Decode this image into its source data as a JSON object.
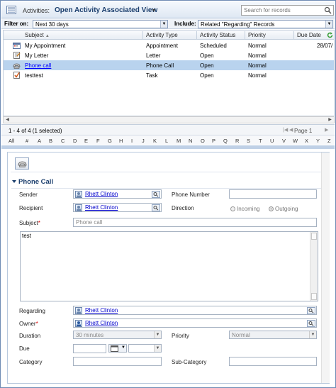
{
  "titlebar": {
    "label": "Activities:",
    "view_title": "Open Activity Associated View",
    "dropdown_symbol": "▾",
    "search_placeholder": "Search for records"
  },
  "filter": {
    "filter_label": "Filter on:",
    "filter_value": "Next 30 days",
    "include_label": "Include:",
    "include_value": "Related \"Regarding\" Records"
  },
  "grid": {
    "columns": [
      "Subject",
      "Activity Type",
      "Activity Status",
      "Priority",
      "Due Date"
    ],
    "sort_indicator": "▲",
    "rows": [
      {
        "icon": "appointment-icon",
        "subject": "My Appointment",
        "type": "Appointment",
        "status": "Scheduled",
        "priority": "Normal",
        "due": "28/07/"
      },
      {
        "icon": "letter-icon",
        "subject": "My Letter",
        "type": "Letter",
        "status": "Open",
        "priority": "Normal",
        "due": ""
      },
      {
        "icon": "phone-call-icon",
        "subject": "Phone call",
        "type": "Phone Call",
        "status": "Open",
        "priority": "Normal",
        "due": ""
      },
      {
        "icon": "task-icon",
        "subject": "testtest",
        "type": "Task",
        "status": "Open",
        "priority": "Normal",
        "due": ""
      }
    ]
  },
  "status": {
    "count_text": "1 - 4 of 4 (1 selected)",
    "page_text": "Page 1"
  },
  "alpha_index": [
    "All",
    "#",
    "A",
    "B",
    "C",
    "D",
    "E",
    "F",
    "G",
    "H",
    "I",
    "J",
    "K",
    "L",
    "M",
    "N",
    "O",
    "P",
    "Q",
    "R",
    "S",
    "T",
    "U",
    "V",
    "W",
    "X",
    "Y",
    "Z"
  ],
  "form": {
    "section_title": "Phone Call",
    "sender_label": "Sender",
    "sender_value": "Rhett Clinton",
    "phone_label": "Phone Number",
    "recipient_label": "Recipient",
    "recipient_value": "Rhett Clinton",
    "direction_label": "Direction",
    "direction_incoming": "Incoming",
    "direction_outgoing": "Outgoing",
    "subject_label": "Subject",
    "subject_value": "Phone call",
    "description_value": "test",
    "regarding_label": "Regarding",
    "regarding_value": "Rhett Clinton",
    "owner_label": "Owner",
    "owner_value": "Rhett Clinton",
    "duration_label": "Duration",
    "duration_value": "30 minutes",
    "priority_label": "Priority",
    "priority_value": "Normal",
    "due_label": "Due",
    "category_label": "Category",
    "subcategory_label": "Sub-Category",
    "required_mark": "*"
  },
  "colors": {
    "accent": "#1c3f6e",
    "selected_row": "#b9d3ee",
    "link": "#0000cc"
  }
}
